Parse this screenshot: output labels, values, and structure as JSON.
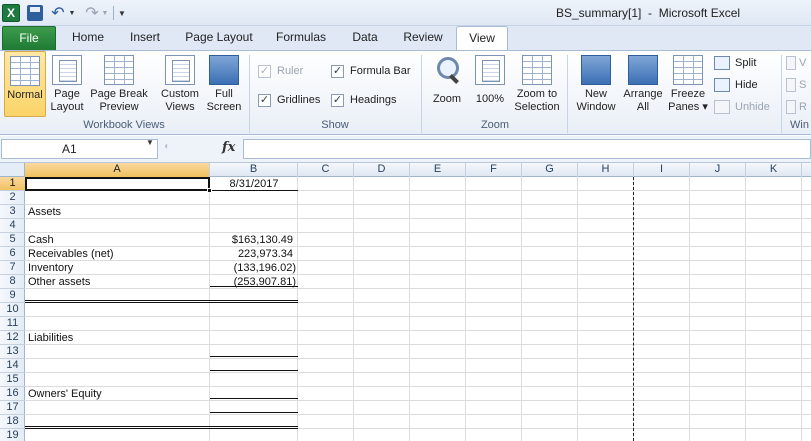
{
  "title_bar": {
    "window_title": "BS_summary[1]  -  Microsoft Excel",
    "app_icon": "X",
    "icons": {
      "app": "excel-icon",
      "save": "save-icon",
      "undo": "undo-icon",
      "redo": "redo-icon",
      "customize": "chevron-down-icon"
    }
  },
  "tabs": [
    "File",
    "Home",
    "Insert",
    "Page Layout",
    "Formulas",
    "Data",
    "Review",
    "View"
  ],
  "active_tab": "View",
  "ribbon": {
    "workbook_views": {
      "label": "Workbook Views",
      "normal": "Normal",
      "page_layout_1": "Page",
      "page_layout_2": "Layout",
      "page_break_1": "Page Break",
      "page_break_2": "Preview",
      "custom_views_1": "Custom",
      "custom_views_2": "Views",
      "full_screen_1": "Full",
      "full_screen_2": "Screen"
    },
    "show": {
      "label": "Show",
      "ruler": "Ruler",
      "gridlines": "Gridlines",
      "formula_bar": "Formula Bar",
      "headings": "Headings",
      "check": "✓"
    },
    "zoom": {
      "label": "Zoom",
      "zoom": "Zoom",
      "hundred": "100%",
      "to_selection_1": "Zoom to",
      "to_selection_2": "Selection",
      "hundred_icon": "100"
    },
    "window": {
      "label": "Win",
      "new_window_1": "New",
      "new_window_2": "Window",
      "arrange_1": "Arrange",
      "arrange_2": "All",
      "freeze_1": "Freeze",
      "freeze_2": "Panes ▾",
      "split": "Split",
      "hide": "Hide",
      "unhide": "Unhide",
      "cut1": "V",
      "cut2": "S",
      "cut3": "R"
    }
  },
  "formula_bar": {
    "name_box": "A1",
    "fx": "fx",
    "formula": ""
  },
  "grid": {
    "columns": [
      "A",
      "B",
      "C",
      "D",
      "E",
      "F",
      "G",
      "H",
      "I",
      "J",
      "K"
    ],
    "rows": [
      "1",
      "2",
      "3",
      "4",
      "5",
      "6",
      "7",
      "8",
      "9",
      "10",
      "11",
      "12",
      "13",
      "14",
      "15",
      "16",
      "17",
      "18",
      "19"
    ],
    "cells": {
      "b1": "8/31/2017",
      "a3": "Assets",
      "a5": "Cash",
      "b5": "$163,130.49",
      "a6": "Receivables (net)",
      "b6": "223,973.34",
      "a7": "Inventory",
      "b7": "(133,196.02)",
      "a8": "Other assets",
      "b8": "(253,907.81)",
      "a11": "Liabilities",
      "a15": "Owners' Equity"
    }
  }
}
